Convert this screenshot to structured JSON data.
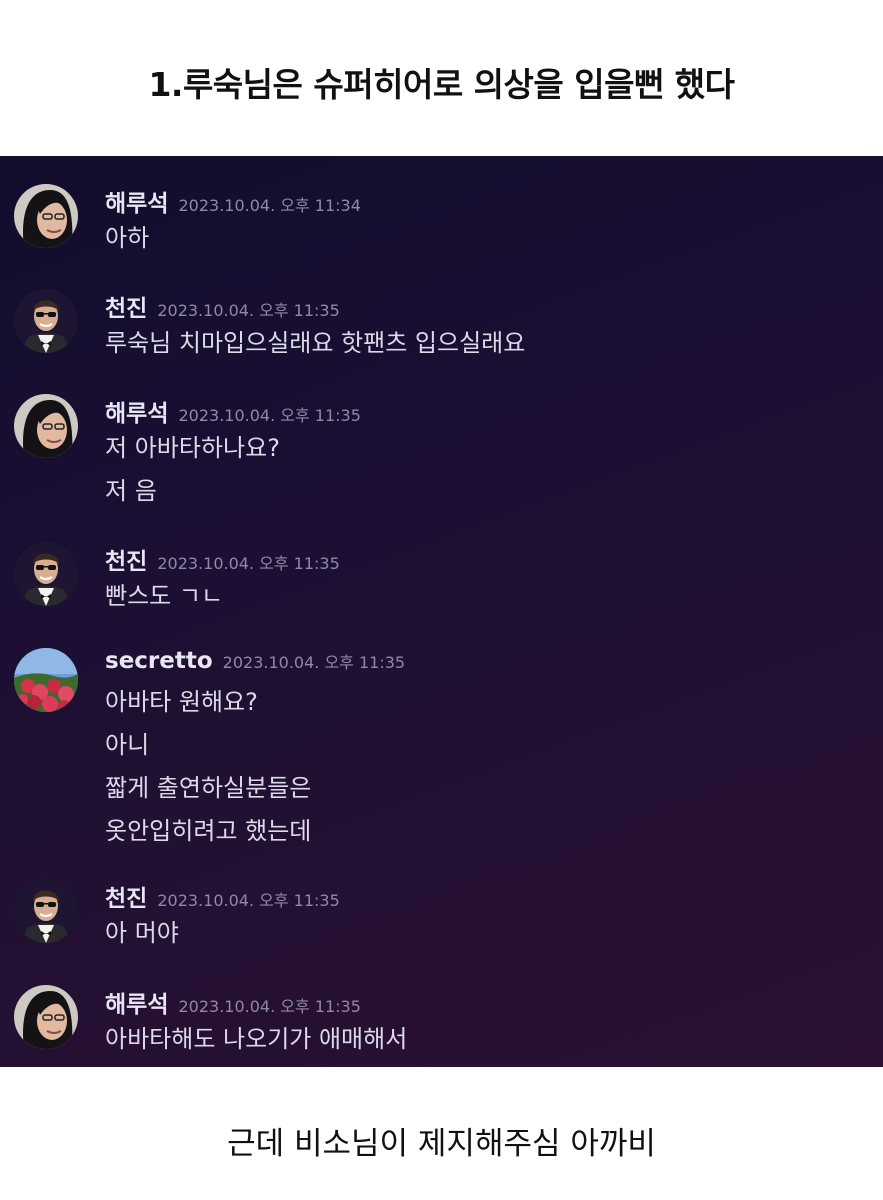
{
  "heading": "1.루숙님은 슈퍼히어로 의상을 입을뻔 했다",
  "caption": "근데 비소님이 제지해주심 아까비",
  "messages": [
    {
      "author": "해루석",
      "avatar": "long-hair-avatar",
      "timestamp": "2023.10.04. 오후 11:34",
      "lines": [
        "아하"
      ]
    },
    {
      "author": "천진",
      "avatar": "tuxedo-avatar",
      "timestamp": "2023.10.04. 오후 11:35",
      "lines": [
        "루숙님 치마입으실래요 핫팬츠 입으실래요"
      ]
    },
    {
      "author": "해루석",
      "avatar": "long-hair-avatar",
      "timestamp": "2023.10.04. 오후 11:35",
      "lines": [
        "저 아바타하나요?",
        "저 음"
      ]
    },
    {
      "author": "천진",
      "avatar": "tuxedo-avatar",
      "timestamp": "2023.10.04. 오후 11:35",
      "lines": [
        "빤스도 ㄱㄴ"
      ]
    },
    {
      "author": "secretto",
      "avatar": "flower-avatar",
      "timestamp": "2023.10.04. 오후 11:35",
      "lines": [
        "아바타 원해요?",
        "아니",
        "짧게 출연하실분들은",
        "옷안입히려고 했는데"
      ]
    },
    {
      "author": "천진",
      "avatar": "tuxedo-avatar",
      "timestamp": "2023.10.04. 오후 11:35",
      "lines": [
        "아 머야"
      ]
    },
    {
      "author": "해루석",
      "avatar": "long-hair-avatar",
      "timestamp": "2023.10.04. 오후 11:35",
      "lines": [
        "아바타해도 나오기가 애매해서"
      ]
    }
  ]
}
